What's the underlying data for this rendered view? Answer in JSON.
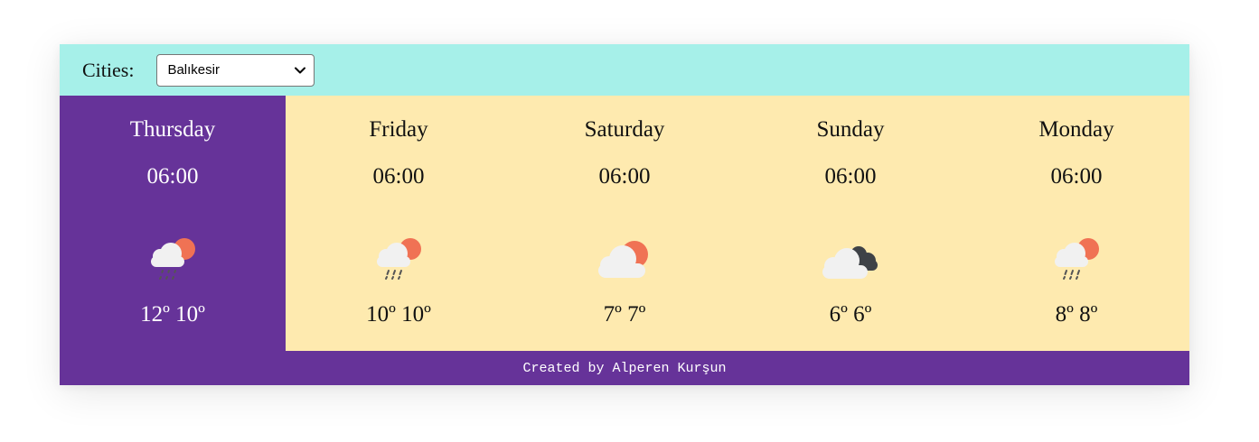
{
  "city_bar": {
    "label": "Cities:",
    "selected_city": "Balıkesir"
  },
  "days": [
    {
      "name": "Thursday",
      "time": "06:00",
      "temp": "12º 10º",
      "icon": "cloud-sun-rain-icon",
      "active": true
    },
    {
      "name": "Friday",
      "time": "06:00",
      "temp": "10º 10º",
      "icon": "cloud-sun-rain-icon",
      "active": false
    },
    {
      "name": "Saturday",
      "time": "06:00",
      "temp": "7º 7º",
      "icon": "cloud-sun-icon",
      "active": false
    },
    {
      "name": "Sunday",
      "time": "06:00",
      "temp": "6º 6º",
      "icon": "dark-clouds-icon",
      "active": false
    },
    {
      "name": "Monday",
      "time": "06:00",
      "temp": "8º 8º",
      "icon": "cloud-sun-rain-icon",
      "active": false
    }
  ],
  "footer": {
    "text": "Created by Alperen Kurşun"
  },
  "colors": {
    "header_bg": "#a6f0e9",
    "active_bg": "#663399",
    "days_bg": "#feeaaf",
    "footer_bg": "#663399",
    "sun": "#f07254",
    "cloud": "#f1f1f1",
    "dark_cloud": "#3e4247",
    "rain": "#555555"
  }
}
